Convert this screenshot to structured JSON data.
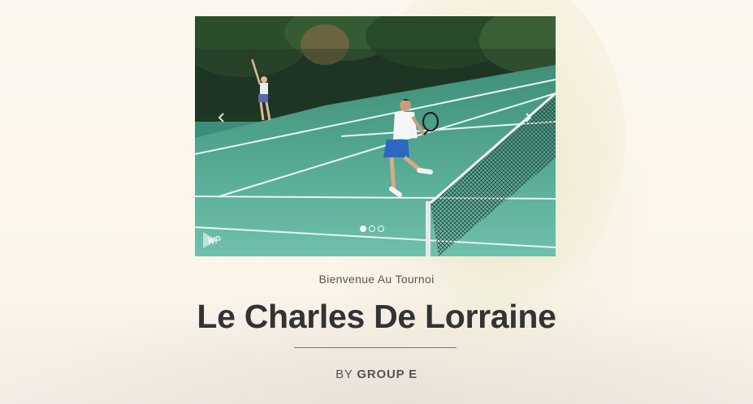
{
  "hero": {
    "subtitle": "Bienvenue Au Tournoi",
    "title": "Le Charles De Lorraine",
    "byline_prefix": "BY",
    "byline_group": "GROUP E"
  },
  "slider": {
    "slide_count": 3,
    "active_slide": 1,
    "prev_icon": "chevron-left-icon",
    "next_icon": "chevron-right-icon",
    "badge_icon": "wp-logo-icon"
  },
  "colors": {
    "court": "#3a9a86",
    "text": "#333333",
    "background": "#fbf6ec"
  }
}
